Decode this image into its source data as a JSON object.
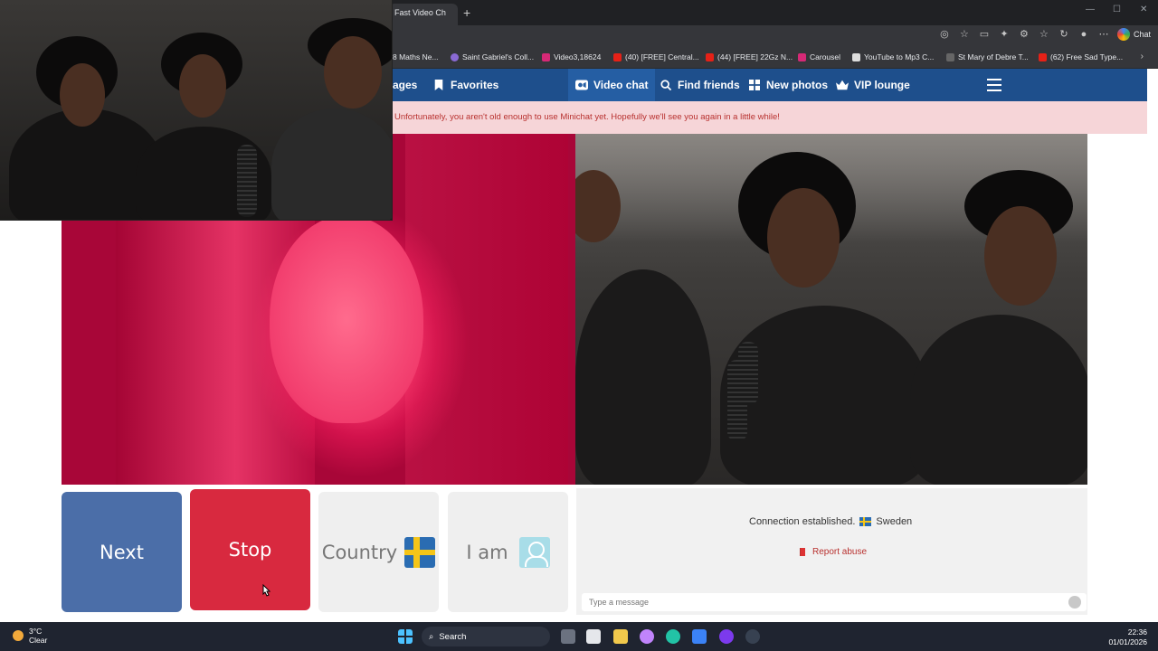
{
  "browser": {
    "tab_title": "Fast Video Ch",
    "new_tab": "+",
    "chat_label": "Chat",
    "bookmarks": [
      "8 Maths Ne...",
      "Saint Gabriel's Coll...",
      "Video3,18624",
      "(40) [FREE] Central...",
      "(44) [FREE] 22Gz N...",
      "Carousel",
      "YouTube to Mp3 C...",
      "St Mary of Debre T...",
      "(62) Free Sad Type..."
    ],
    "bookmark_more": "›"
  },
  "nav": {
    "items": [
      {
        "label": "ages"
      },
      {
        "label": "Favorites"
      },
      {
        "label": "Video chat"
      },
      {
        "label": "Find friends"
      },
      {
        "label": "New photos"
      },
      {
        "label": "VIP lounge"
      }
    ]
  },
  "warning": "Unfortunately, you aren't old enough to use Minichat yet. Hopefully we'll see you again in a little while!",
  "controls": {
    "next": "Next",
    "stop": "Stop",
    "country": "Country",
    "iam": "I am"
  },
  "chat": {
    "status": "Connection established.",
    "country": "Sweden",
    "report": "Report abuse",
    "placeholder": "Type a message"
  },
  "taskbar": {
    "temp": "3°C",
    "condition": "Clear",
    "search": "Search",
    "time": "22:36",
    "date": "01/01/2026"
  },
  "colors": {
    "nav_bg": "#1e4f8c",
    "next_btn": "#4b6ea8",
    "stop_btn": "#d8293f",
    "warning_bg": "#f6d5d8"
  }
}
